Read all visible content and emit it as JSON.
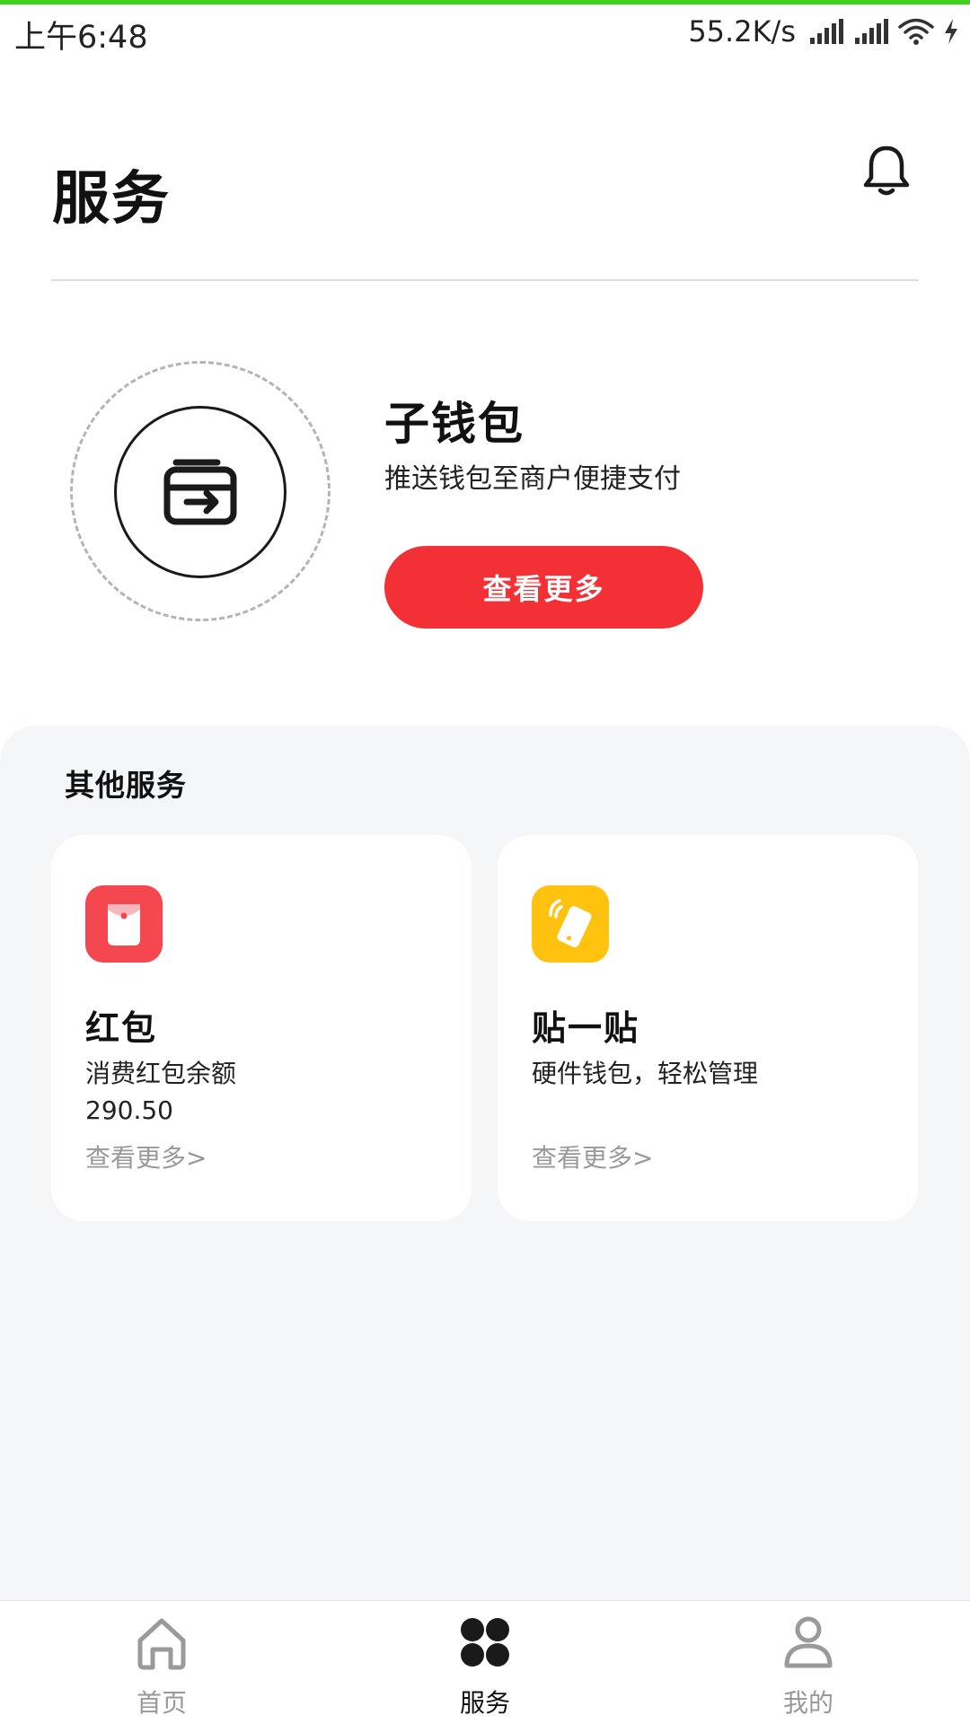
{
  "status_bar": {
    "time": "上午6:48",
    "net_speed": "55.2K/s"
  },
  "header": {
    "title": "服务"
  },
  "hero": {
    "title": "子钱包",
    "subtitle": "推送钱包至商户便捷支付",
    "button_label": "查看更多"
  },
  "other_services": {
    "title": "其他服务",
    "cards": [
      {
        "title": "红包",
        "desc": "消费红包余额",
        "amount": "290.50",
        "link": "查看更多>",
        "icon": "red-envelope-icon",
        "icon_color": "#f4474f"
      },
      {
        "title": "贴一贴",
        "desc": "硬件钱包，轻松管理",
        "link": "查看更多>",
        "icon": "tap-phone-icon",
        "icon_color": "#ffc20e"
      }
    ]
  },
  "bottom_nav": {
    "items": [
      {
        "label": "首页",
        "icon": "home-icon",
        "active": false
      },
      {
        "label": "服务",
        "icon": "services-grid-icon",
        "active": true
      },
      {
        "label": "我的",
        "icon": "profile-icon",
        "active": false
      }
    ]
  },
  "colors": {
    "accent_red": "#f23036",
    "status_bar_accent": "#3fd21a",
    "panel_background": "#f5f6f8",
    "muted_text": "#999999"
  }
}
